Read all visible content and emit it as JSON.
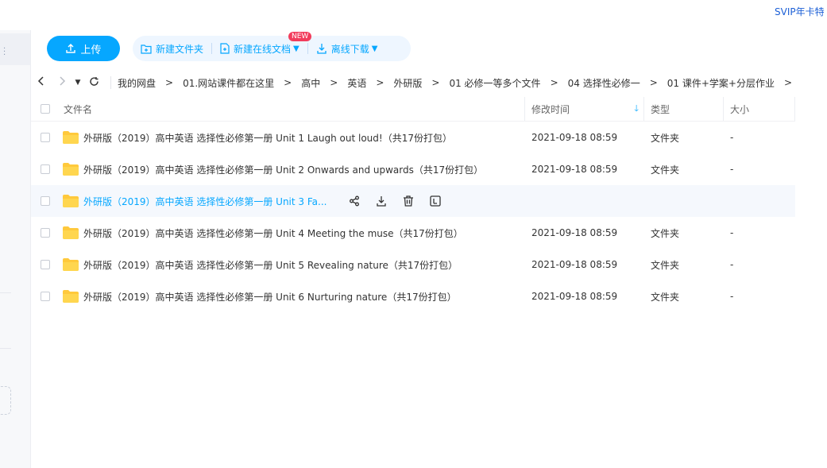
{
  "top": {
    "svip_text": "SVIP年卡特"
  },
  "toolbar": {
    "upload_label": "上传",
    "new_folder_label": "新建文件夹",
    "new_doc_label": "新建在线文档",
    "new_badge": "NEW",
    "offline_download_label": "离线下载"
  },
  "breadcrumb": [
    "我的网盘",
    "01.网站课件都在这里",
    "高中",
    "英语",
    "外研版",
    "01 必修一等多个文件",
    "04 选择性必修一",
    "01  课件+学案+分层作业"
  ],
  "breadcrumb_separator": ">",
  "table": {
    "headers": {
      "name": "文件名",
      "time": "修改时间",
      "type": "类型",
      "size": "大小"
    },
    "sort_icon": "arrow-down-icon",
    "rows": [
      {
        "name": "外研版（2019）高中英语 选择性必修第一册 Unit 1   Laugh out loud!（共17份打包）",
        "time": "2021-09-18 08:59",
        "type": "文件夹",
        "size": "-"
      },
      {
        "name": "外研版（2019）高中英语 选择性必修第一册 Unit 2   Onwards and upwards（共17份打包）",
        "time": "2021-09-18 08:59",
        "type": "文件夹",
        "size": "-"
      },
      {
        "name": "外研版（2019）高中英语 选择性必修第一册 Unit 3   Fa...",
        "time": "",
        "type": "",
        "size": ""
      },
      {
        "name": "外研版（2019）高中英语 选择性必修第一册 Unit 4   Meeting the muse（共17份打包）",
        "time": "2021-09-18 08:59",
        "type": "文件夹",
        "size": "-"
      },
      {
        "name": "外研版（2019）高中英语 选择性必修第一册 Unit 5   Revealing nature（共17份打包）",
        "time": "2021-09-18 08:59",
        "type": "文件夹",
        "size": "-"
      },
      {
        "name": "外研版（2019）高中英语 选择性必修第一册 Unit 6   Nurturing nature（共17份打包）",
        "time": "2021-09-18 08:59",
        "type": "文件夹",
        "size": "-"
      }
    ]
  },
  "colors": {
    "accent": "#06a7ff",
    "folder": "#ffc93c",
    "badge": "#f23d5c"
  }
}
